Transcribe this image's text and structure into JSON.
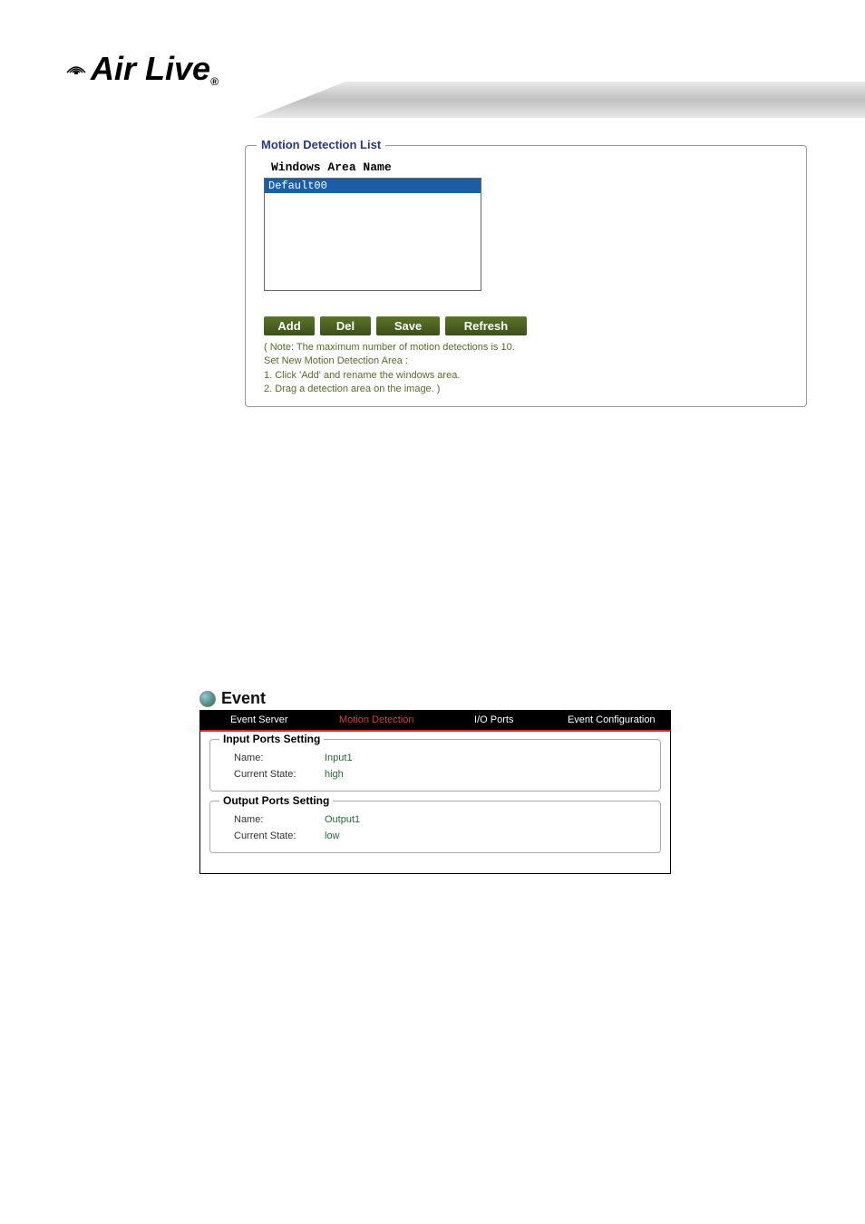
{
  "logo": {
    "text": "Air Live",
    "registration": "®"
  },
  "motion_section": {
    "fieldset_title": "Motion Detection List",
    "windows_label": "Windows Area Name",
    "list_items": [
      "Default00"
    ],
    "buttons": {
      "add": "Add",
      "del": "Del",
      "save": "Save",
      "refresh": "Refresh"
    },
    "notes": {
      "line1": "( Note: The maximum number of motion detections is 10.",
      "line2": "Set New Motion Detection Area :",
      "line3": "1. Click 'Add' and rename the windows area.",
      "line4": "2. Drag a detection area on the image. )"
    }
  },
  "event_section": {
    "title": "Event",
    "tabs": {
      "event_server": "Event Server",
      "motion_detection": "Motion Detection",
      "io_ports": "I/O Ports",
      "event_config": "Event Configuration"
    },
    "input_ports": {
      "title": "Input Ports Setting",
      "name_label": "Name:",
      "name_value": "Input1",
      "state_label": "Current State:",
      "state_value": "high"
    },
    "output_ports": {
      "title": "Output Ports Setting",
      "name_label": "Name:",
      "name_value": "Output1",
      "state_label": "Current State:",
      "state_value": "low"
    }
  }
}
